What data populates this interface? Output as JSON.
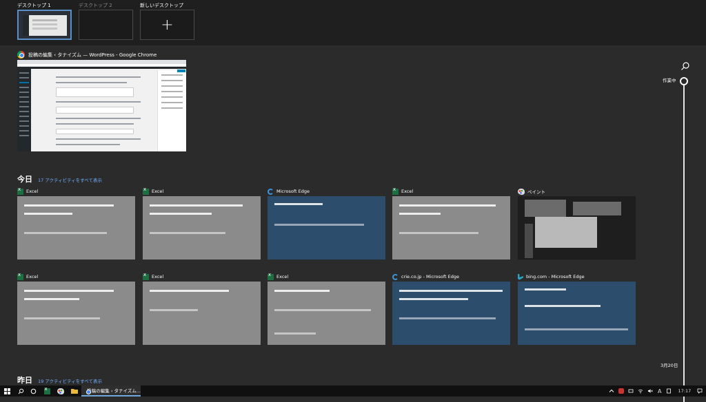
{
  "desktops": {
    "items": [
      {
        "label": "デスクトップ 1"
      },
      {
        "label": "デスクトップ 2"
      },
      {
        "label": "新しいデスクトップ"
      }
    ],
    "new_symbol": "+"
  },
  "open_window": {
    "title": "投稿の編集 ‹ タナイズム — WordPress - Google Chrome"
  },
  "today": {
    "heading": "今日",
    "link": "17 アクティビティをすべて表示"
  },
  "yesterday": {
    "heading": "昨日",
    "link": "19 アクティビティをすべて表示"
  },
  "activities": [
    {
      "app": "Excel",
      "icon": "excel-icon"
    },
    {
      "app": "Excel",
      "icon": "excel-icon"
    },
    {
      "app": "Microsoft Edge",
      "icon": "edge-icon"
    },
    {
      "app": "Excel",
      "icon": "excel-icon"
    },
    {
      "app": "ペイント",
      "icon": "paint-icon"
    },
    {
      "app": "Excel",
      "icon": "excel-icon"
    },
    {
      "app": "Excel",
      "icon": "excel-icon"
    },
    {
      "app": "Excel",
      "icon": "excel-icon"
    },
    {
      "app": "crie.co.jp - Microsoft Edge",
      "icon": "edge-icon"
    },
    {
      "app": "bing.com - Microsoft Edge",
      "icon": "bing-icon"
    }
  ],
  "timeline": {
    "active_label": "作業中",
    "date_label": "3月20日"
  },
  "taskbar": {
    "chrome_label": "投稿の編集 ‹ タナイズム...",
    "ime": "A",
    "clock": "17:17"
  },
  "colors": {
    "background": "#2b2b2b",
    "excel_thumb": "#8b8b8b",
    "edge_thumb": "#2d4d6d",
    "link": "#6fb0ff",
    "selected_desktop": "#5b8fc7"
  }
}
